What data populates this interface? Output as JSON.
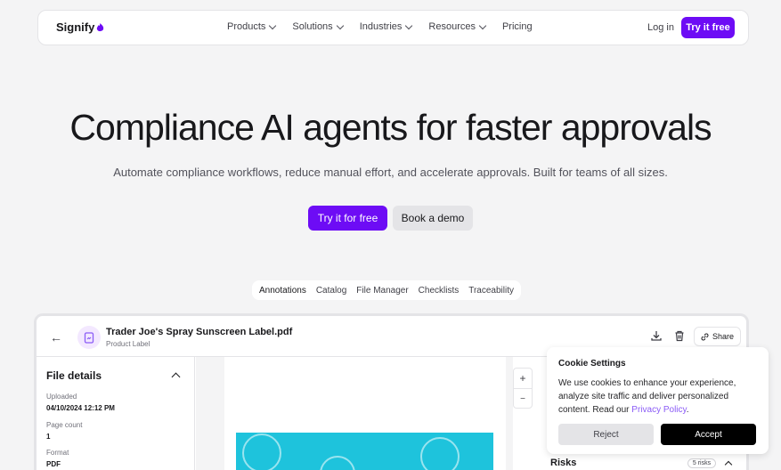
{
  "nav": {
    "brand": "Signify",
    "items": [
      {
        "label": "Products",
        "has_dropdown": true
      },
      {
        "label": "Solutions",
        "has_dropdown": true
      },
      {
        "label": "Industries",
        "has_dropdown": true
      },
      {
        "label": "Resources",
        "has_dropdown": true
      },
      {
        "label": "Pricing",
        "has_dropdown": false
      }
    ],
    "login": "Log in",
    "cta": "Try it free"
  },
  "hero": {
    "title": "Compliance AI agents for faster approvals",
    "subtitle": "Automate compliance workflows, reduce manual effort, and accelerate approvals. Built for teams of all sizes.",
    "primary_button": "Try it for free",
    "secondary_button": "Book a demo"
  },
  "tabs": [
    "Annotations",
    "Catalog",
    "File Manager",
    "Checklists",
    "Traceability"
  ],
  "active_tab": "Annotations",
  "app": {
    "file_name": "Trader Joe's Spray Sunscreen Label.pdf",
    "file_type": "Product Label",
    "share_label": "Share",
    "sidebar": {
      "title": "File details",
      "fields": [
        {
          "label": "Uploaded",
          "value": "04/10/2024  12:12 PM"
        },
        {
          "label": "Page count",
          "value": "1"
        },
        {
          "label": "Format",
          "value": "PDF"
        }
      ]
    },
    "zoom_in": "+",
    "zoom_out": "−"
  },
  "cookie": {
    "title": "Cookie Settings",
    "text": "We use cookies to enhance your experience, analyze site traffic and deliver personalized content. Read our",
    "link": "Privacy Policy",
    "text_end": ".",
    "reject": "Reject",
    "accept": "Accept"
  },
  "risks": {
    "title": "Risks",
    "badge": "5 risks"
  },
  "colors": {
    "accent": "#6d0cf5",
    "background": "#f4f4f5",
    "label_cyan": "#1ec3dc",
    "link": "#8b5cf6"
  }
}
